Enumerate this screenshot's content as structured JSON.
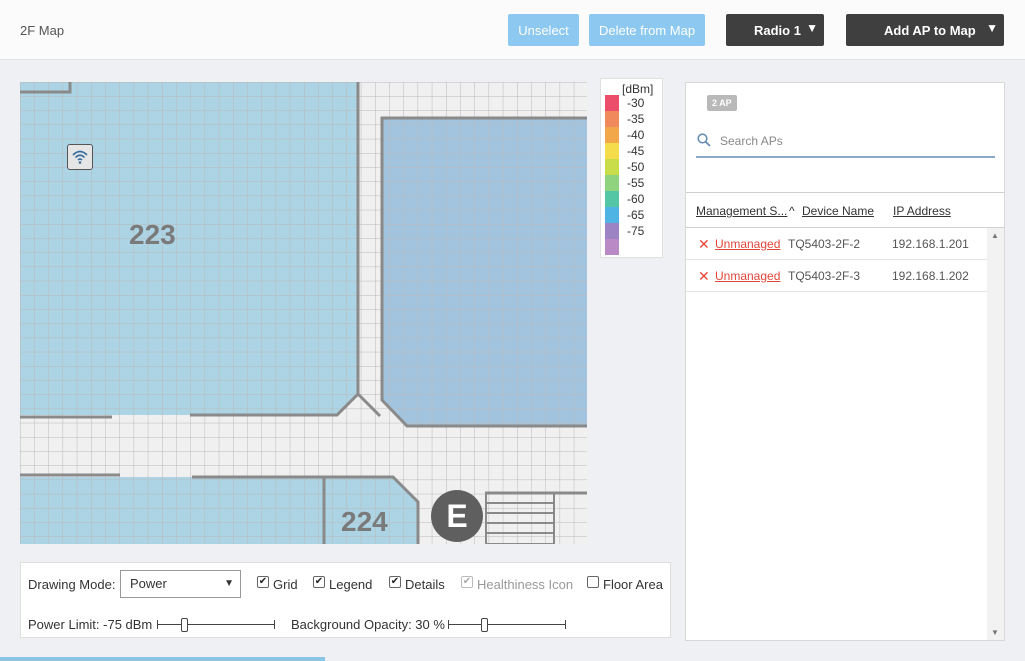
{
  "header": {
    "title": "2F Map",
    "unselect_label": "Unselect",
    "delete_label": "Delete from Map",
    "radio_label": "Radio 1",
    "add_ap_label": "Add AP to Map",
    "caret": "▼"
  },
  "map": {
    "rooms": [
      "223",
      "224"
    ],
    "elevator_label": "E",
    "ap_icon": "wifi-icon"
  },
  "legend": {
    "unit": "[dBm]",
    "entries": [
      {
        "value": "-30",
        "color": "#ec4d6b"
      },
      {
        "value": "-35",
        "color": "#f08a5d"
      },
      {
        "value": "-40",
        "color": "#f2a84a"
      },
      {
        "value": "-45",
        "color": "#f5dc4a"
      },
      {
        "value": "-50",
        "color": "#c9dc4a"
      },
      {
        "value": "-55",
        "color": "#8fd37f"
      },
      {
        "value": "-60",
        "color": "#54c5a5"
      },
      {
        "value": "-65",
        "color": "#4fb3e3"
      },
      {
        "value": "-75",
        "color": "#9b83c4"
      },
      {
        "value": "",
        "color": "#b98ac6"
      }
    ]
  },
  "controls": {
    "drawing_mode_label": "Drawing Mode:",
    "drawing_mode_value": "Power",
    "grid_label": "Grid",
    "legend_label": "Legend",
    "details_label": "Details",
    "healthiness_label": "Healthiness Icon",
    "floor_area_label": "Floor Area",
    "power_limit_label": "Power Limit: -75 dBm",
    "power_limit_fraction": 0.22,
    "bg_opacity_label": "Background Opacity: 30 %",
    "bg_opacity_fraction": 0.3,
    "grid_checked": true,
    "legend_checked": true,
    "details_checked": true,
    "healthiness_checked": true,
    "floor_area_checked": false
  },
  "panel": {
    "ap_count": "2 AP",
    "search_placeholder": "Search APs",
    "columns": [
      "Management S...",
      "Device Name",
      "IP Address"
    ],
    "sort_indicator": "^",
    "rows": [
      {
        "status": "Unmanaged",
        "device": "TQ5403-2F-2",
        "ip": "192.168.1.201"
      },
      {
        "status": "Unmanaged",
        "device": "TQ5403-2F-3",
        "ip": "192.168.1.202"
      }
    ]
  },
  "colors": {
    "accent": "#8cc8ef",
    "dark_button": "#3f3f3f",
    "room_fill": "#acd4e4",
    "room_fill_dark": "#a3c4df",
    "error": "#e8463a"
  }
}
